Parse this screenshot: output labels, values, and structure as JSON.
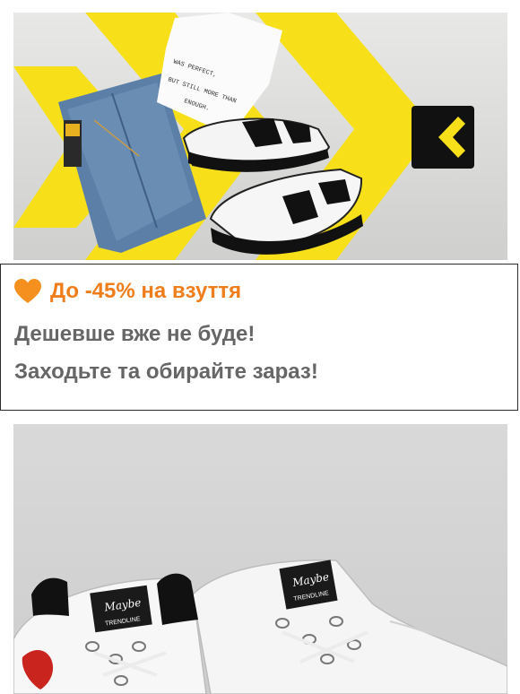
{
  "banner": {
    "tshirt_print_lines": [
      "WAS PERFECT,",
      "BUT STILL MORE THAN",
      "ENOUGH."
    ],
    "accent_color": "#f7e01a",
    "logo_icon": "chevron-left-logo-icon"
  },
  "promo": {
    "icon": "orange-heart-icon",
    "title": "До -45% на взуття",
    "subtitle_1": "Дешевше вже не буде!",
    "subtitle_2": "Заходьте та обирайте зараз!",
    "title_color": "#f07d1c",
    "text_color": "#666666"
  },
  "product": {
    "label_brand": "Maybe",
    "label_collection": "TRENDLINE"
  }
}
